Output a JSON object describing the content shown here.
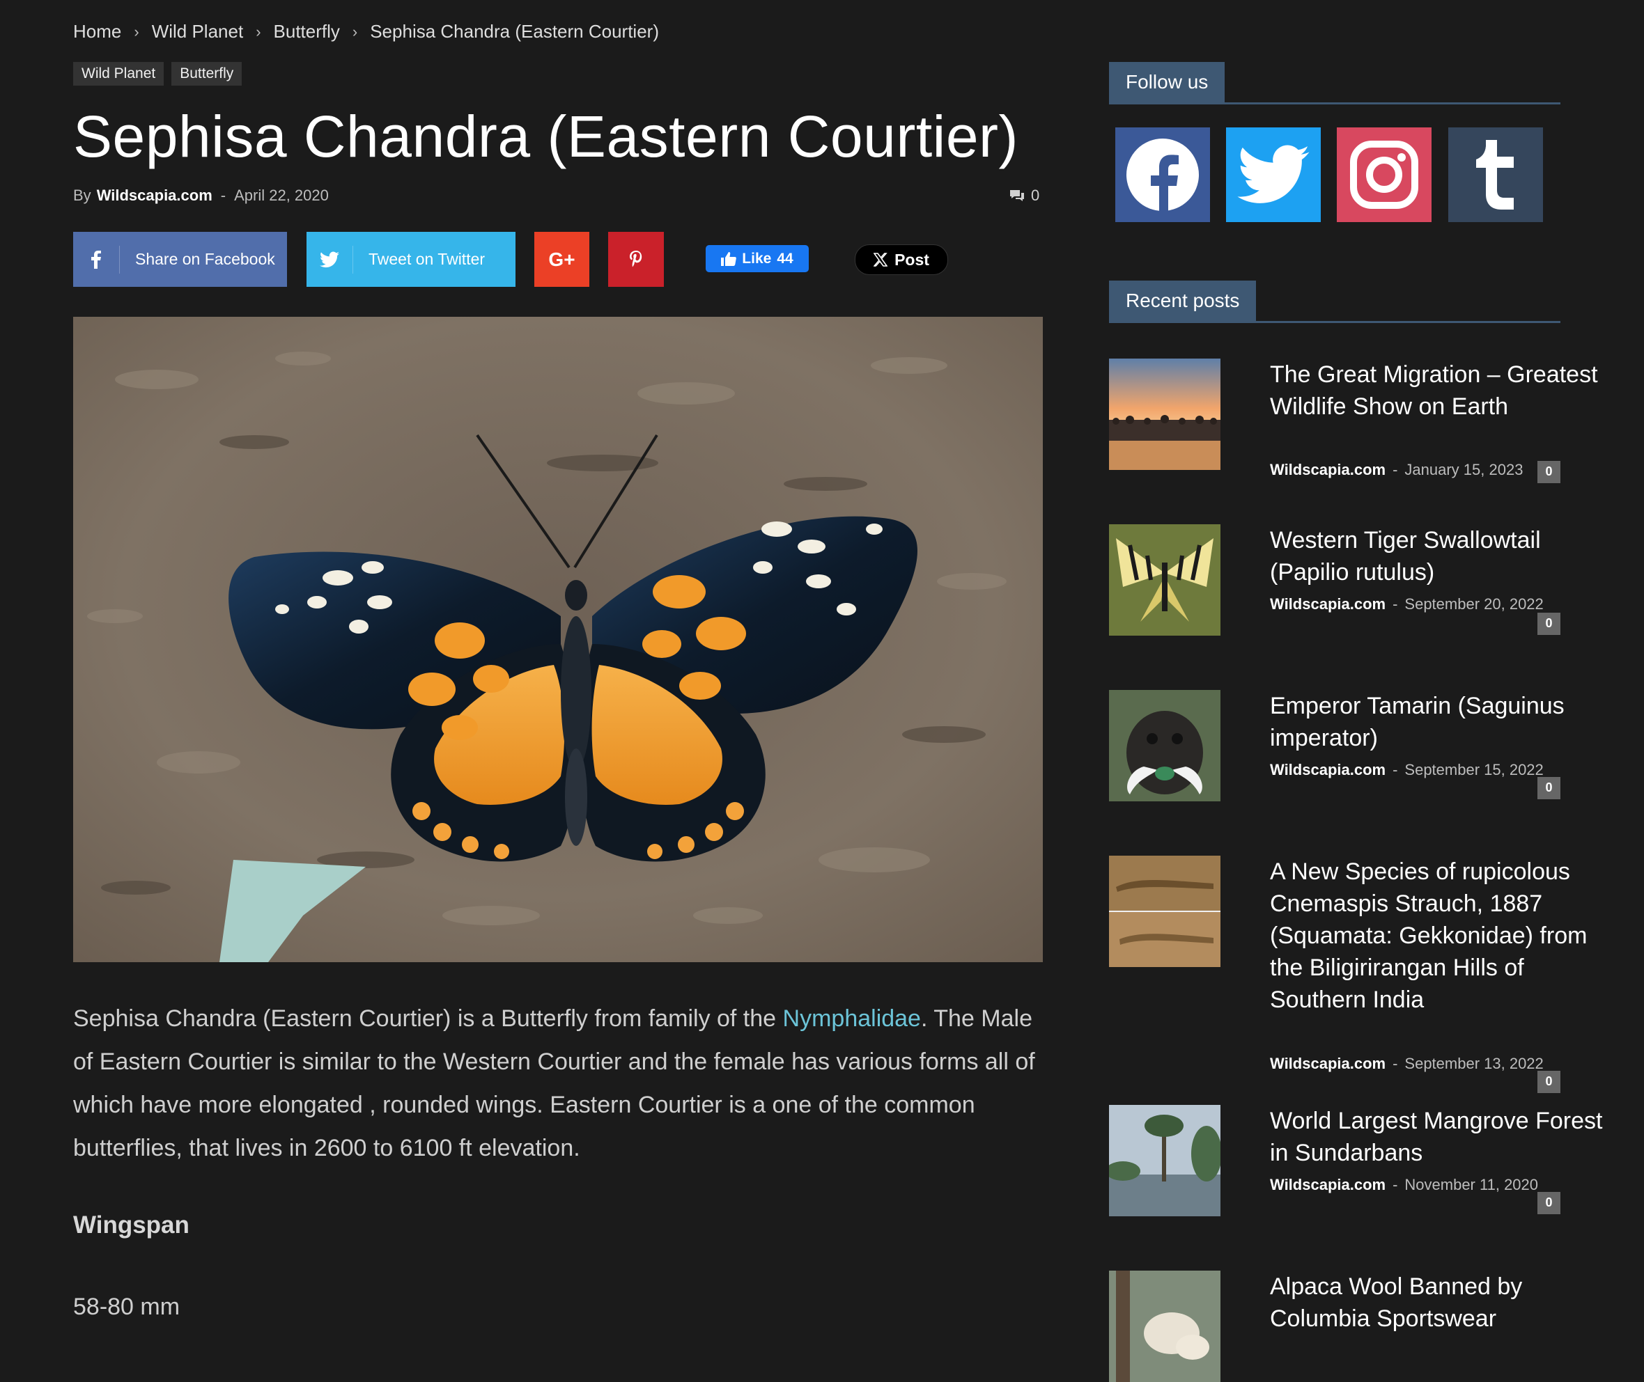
{
  "breadcrumb": {
    "home": "Home",
    "cat1": "Wild Planet",
    "cat2": "Butterfly",
    "current": "Sephisa Chandra (Eastern Courtier)",
    "sep": "›"
  },
  "tags": [
    "Wild Planet",
    "Butterfly"
  ],
  "article": {
    "title": "Sephisa Chandra (Eastern Courtier)",
    "by": "By",
    "author": "Wildscapia.com",
    "dash": "-",
    "date": "April 22, 2020",
    "comment_count": "0"
  },
  "share": {
    "facebook": "Share on Facebook",
    "twitter": "Tweet on Twitter",
    "gplus": "G+",
    "fb_like": "Like",
    "fb_like_count": "44",
    "x_post": "Post"
  },
  "content": {
    "para_before_link": "Sephisa Chandra (Eastern Courtier) is a Butterfly from family of  the ",
    "link": "Nymphalidae",
    "para_after_link": ". The Male of Eastern Courtier is similar to the Western Courtier and the female has various forms all of which have more elongated , rounded wings. Eastern Courtier is a one of the common butterflies, that lives in 2600 to 6100 ft elevation.",
    "subheading": "Wingspan",
    "wingspan_value": "58-80 mm"
  },
  "sidebar": {
    "follow_title": "Follow us",
    "recent_title": "Recent posts",
    "social": [
      {
        "name": "facebook-icon",
        "color": "#3b5998"
      },
      {
        "name": "twitter-icon",
        "color": "#1da1f2"
      },
      {
        "name": "instagram-icon",
        "color": "#d8485f"
      },
      {
        "name": "tumblr-icon",
        "color": "#35465c"
      }
    ],
    "posts": [
      {
        "title": "The Great Migration – Greatest Wildlife Show on Earth",
        "author": "Wildscapia.com",
        "date": "January 15, 2023",
        "comments": "0"
      },
      {
        "title": "Western Tiger Swallowtail (Papilio rutulus)",
        "author": "Wildscapia.com",
        "date": "September 20, 2022",
        "comments": "0"
      },
      {
        "title": "Emperor Tamarin (Saguinus imperator)",
        "author": "Wildscapia.com",
        "date": "September 15, 2022",
        "comments": "0"
      },
      {
        "title": "A New Species of rupicolous Cnemaspis Strauch, 1887 (Squamata: Gekkonidae) from the Biligirirangan Hills of Southern India",
        "author": "Wildscapia.com",
        "date": "September 13, 2022",
        "comments": "0"
      },
      {
        "title": "World Largest Mangrove Forest in Sundarbans",
        "author": "Wildscapia.com",
        "date": "November 11, 2020",
        "comments": "0"
      },
      {
        "title": "Alpaca Wool Banned by Columbia Sportswear",
        "author": "",
        "date": "",
        "comments": ""
      }
    ]
  }
}
